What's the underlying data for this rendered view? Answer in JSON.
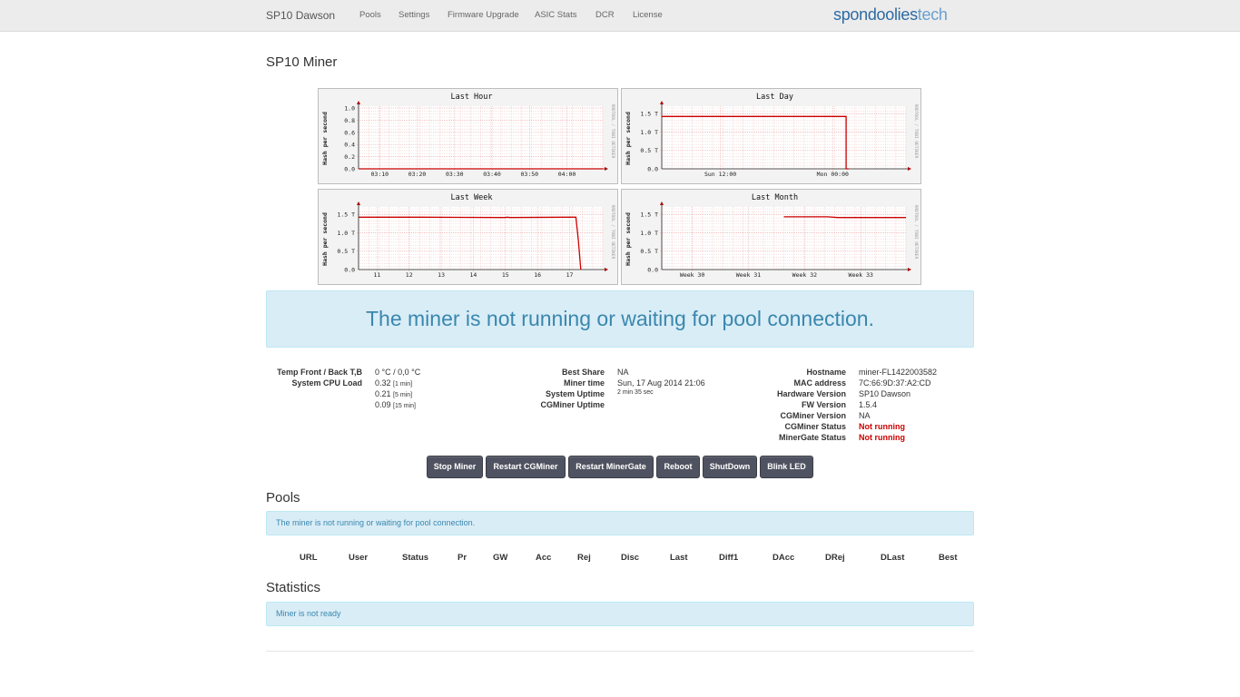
{
  "nav": {
    "brand": "SP10 Dawson",
    "items": [
      "Pools",
      "Settings",
      "Firmware Upgrade",
      "ASIC Stats",
      "DCR",
      "License"
    ],
    "logo_part1": "spondoolies",
    "logo_part2": "tech"
  },
  "page_title": "SP10 Miner",
  "chart_data": [
    {
      "type": "line",
      "title": "Last Hour",
      "ylabel": "Hash per second",
      "side_label": "RRDTOOL / TOBI OETIKER",
      "yticks": [
        "1.0",
        "0.8",
        "0.6",
        "0.4",
        "0.2",
        "0.0"
      ],
      "ylim": [
        0,
        1.0
      ],
      "xticks": [
        "03:10",
        "03:20",
        "03:30",
        "03:40",
        "03:50",
        "04:00"
      ],
      "series": [
        {
          "x": [
            0,
            100
          ],
          "values": [
            0,
            0
          ],
          "color": "#cc0000"
        }
      ]
    },
    {
      "type": "line",
      "title": "Last Day",
      "ylabel": "Hash per second",
      "side_label": "RRDTOOL / TOBI OETIKER",
      "yticks": [
        "1.5 T",
        "1.0 T",
        "0.5 T",
        "0.0"
      ],
      "ylim": [
        0,
        1.65
      ],
      "xticks": [
        "Sun 12:00",
        "Mon 00:00"
      ],
      "series": [
        {
          "x": [
            0,
            75.5,
            75.5,
            76.5
          ],
          "values": [
            1.42,
            1.42,
            0,
            0
          ],
          "color": "#cc0000"
        }
      ]
    },
    {
      "type": "line",
      "title": "Last Week",
      "ylabel": "Hash per second",
      "side_label": "RRDTOOL / TOBI OETIKER",
      "yticks": [
        "1.5 T",
        "1.0 T",
        "0.5 T",
        "0.0"
      ],
      "ylim": [
        0,
        1.65
      ],
      "xticks": [
        "11",
        "12",
        "13",
        "14",
        "15",
        "16",
        "17"
      ],
      "series": [
        {
          "x": [
            0,
            25,
            60,
            61,
            62,
            85,
            88,
            89,
            90,
            91
          ],
          "values": [
            1.42,
            1.42,
            1.41,
            1.42,
            1.41,
            1.42,
            1.42,
            1.42,
            0.8,
            0
          ],
          "color": "#cc0000"
        }
      ]
    },
    {
      "type": "line",
      "title": "Last Month",
      "ylabel": "Hash per second",
      "side_label": "RRDTOOL / TOBI OETIKER",
      "yticks": [
        "1.5 T",
        "1.0 T",
        "0.5 T",
        "0.0"
      ],
      "ylim": [
        0,
        1.65
      ],
      "xticks": [
        "Week 30",
        "Week 31",
        "Week 32",
        "Week 33"
      ],
      "series": [
        {
          "x": [
            50,
            68,
            72,
            100
          ],
          "values": [
            1.43,
            1.43,
            1.41,
            1.41
          ],
          "color": "#cc0000"
        }
      ]
    }
  ],
  "status_message": "The miner is not running or waiting for pool connection.",
  "info": {
    "temp_label": "Temp Front / Back T,B",
    "temp_value": "0 °C / 0,0 °C",
    "cpu_label": "System CPU Load",
    "cpu": [
      {
        "value": "0.32",
        "period": "[1 min]"
      },
      {
        "value": "0.21",
        "period": "[5 min]"
      },
      {
        "value": "0.09",
        "period": "[15 min]"
      }
    ],
    "best_share_label": "Best Share",
    "best_share": "NA",
    "miner_time_label": "Miner time",
    "miner_time": "Sun, 17 Aug 2014 21:06",
    "uptime_label": "System Uptime",
    "uptime": "2 min 35 sec",
    "cg_uptime_label": "CGMiner Uptime",
    "cg_uptime": "",
    "hostname_label": "Hostname",
    "hostname": "miner-FL1422003582",
    "mac_label": "MAC address",
    "mac": "7C:66:9D:37:A2:CD",
    "hw_label": "Hardware Version",
    "hw": "SP10 Dawson",
    "fw_label": "FW Version",
    "fw": "1.5.4",
    "cgv_label": "CGMiner Version",
    "cgv": "NA",
    "cgs_label": "CGMiner Status",
    "cgs": "Not running",
    "mgs_label": "MinerGate Status",
    "mgs": "Not running"
  },
  "buttons": [
    "Stop Miner",
    "Restart CGMiner",
    "Restart MinerGate",
    "Reboot",
    "ShutDown",
    "Blink LED"
  ],
  "pools": {
    "title": "Pools",
    "message": "The miner is not running or waiting for pool connection.",
    "columns": [
      "URL",
      "User",
      "Status",
      "Pr",
      "GW",
      "Acc",
      "Rej",
      "Disc",
      "Last",
      "Diff1",
      "DAcc",
      "DRej",
      "DLast",
      "Best"
    ]
  },
  "statistics": {
    "title": "Statistics",
    "message": "Miner is not ready"
  },
  "colors": {
    "alert_bg": "#d9edf7",
    "alert_text": "#3a87ad",
    "button_bg": "#4f5260",
    "status_red": "#cc0000",
    "chart_line": "#cc0000"
  }
}
